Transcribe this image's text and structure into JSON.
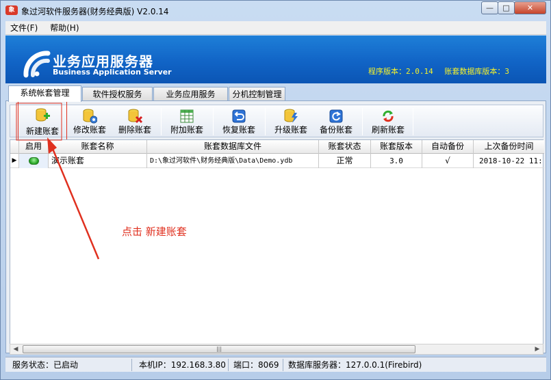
{
  "window": {
    "title": "象过河软件服务器(财务经典版) V2.0.14",
    "app_icon_label": "象",
    "controls": {
      "minimize": "—",
      "maximize": "□",
      "close": "✕"
    }
  },
  "menu": [
    {
      "label": "文件(F)"
    },
    {
      "label": "帮助(H)"
    }
  ],
  "banner": {
    "title": "业务应用服务器",
    "subtitle": "Business Application Server",
    "program_version": "程序版本：2.0.14",
    "db_version": "账套数据库版本：3"
  },
  "tabs": [
    {
      "label": "系统帐套管理",
      "active": true
    },
    {
      "label": "软件授权服务",
      "active": false
    },
    {
      "label": "业务应用服务",
      "active": false
    },
    {
      "label": "分机控制管理",
      "active": false
    }
  ],
  "toolbar": [
    {
      "label": "新建账套",
      "icon": "db-add-icon"
    },
    {
      "label": "修改账套",
      "icon": "db-edit-icon"
    },
    {
      "label": "删除账套",
      "icon": "db-delete-icon"
    },
    {
      "label": "附加账套",
      "icon": "table-attach-icon"
    },
    {
      "label": "恢复账套",
      "icon": "restore-icon"
    },
    {
      "label": "升级账套",
      "icon": "upgrade-icon"
    },
    {
      "label": "备份账套",
      "icon": "backup-icon"
    },
    {
      "label": "刷新账套",
      "icon": "refresh-icon"
    }
  ],
  "grid": {
    "columns": [
      "启用",
      "账套名称",
      "账套数据库文件",
      "账套状态",
      "账套版本",
      "自动备份",
      "上次备份时间"
    ],
    "rows": [
      {
        "enabled": true,
        "name": "演示账套",
        "file": "D:\\象过河软件\\财务经典版\\Data\\Demo.ydb",
        "status": "正常",
        "version": "3.0",
        "auto_backup": "√",
        "last_backup": "2018-10-22 11:"
      }
    ],
    "scrollbar": {
      "left_arrow": "◀",
      "right_arrow": "▶",
      "thumb_grip": "|||"
    }
  },
  "annotation": "点击  新建账套",
  "statusbar": {
    "service_state": "服务状态：已启动",
    "local_ip": "本机IP：192.168.3.80",
    "port": "端口：8069",
    "db_server": "数据库服务器：127.0.0.1(Firebird)"
  },
  "colors": {
    "banner_top": "#1e7fd8",
    "banner_bottom": "#0b55b4",
    "version_text": "#f6f22a",
    "annotation": "#e0301f",
    "close_button": "#c6442a"
  }
}
